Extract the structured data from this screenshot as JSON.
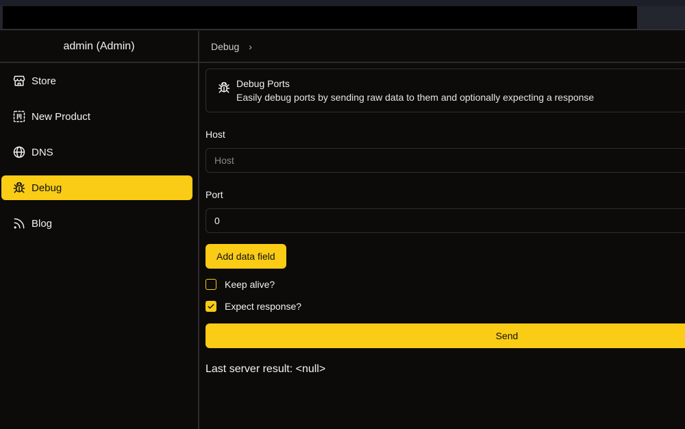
{
  "sidebar": {
    "user_label": "admin (Admin)",
    "items": [
      {
        "label": "Store",
        "icon": "store-icon",
        "active": false
      },
      {
        "label": "New Product",
        "icon": "new-product-icon",
        "active": false
      },
      {
        "label": "DNS",
        "icon": "globe-icon",
        "active": false
      },
      {
        "label": "Debug",
        "icon": "bug-icon",
        "active": true
      },
      {
        "label": "Blog",
        "icon": "rss-icon",
        "active": false
      }
    ]
  },
  "breadcrumb": {
    "current": "Debug"
  },
  "alert": {
    "title": "Debug Ports",
    "description": "Easily debug ports by sending raw data to them and optionally expecting a response"
  },
  "form": {
    "host": {
      "label": "Host",
      "placeholder": "Host",
      "value": ""
    },
    "port": {
      "label": "Port",
      "value": "0"
    },
    "add_data_field_label": "Add data field",
    "keep_alive": {
      "label": "Keep alive?",
      "checked": false
    },
    "expect_response": {
      "label": "Expect response?",
      "checked": true
    },
    "send_label": "Send"
  },
  "result": {
    "text": "Last server result: <null>"
  },
  "colors": {
    "accent": "#facc15",
    "background": "#0c0b0a",
    "border": "#2e2e2e"
  }
}
